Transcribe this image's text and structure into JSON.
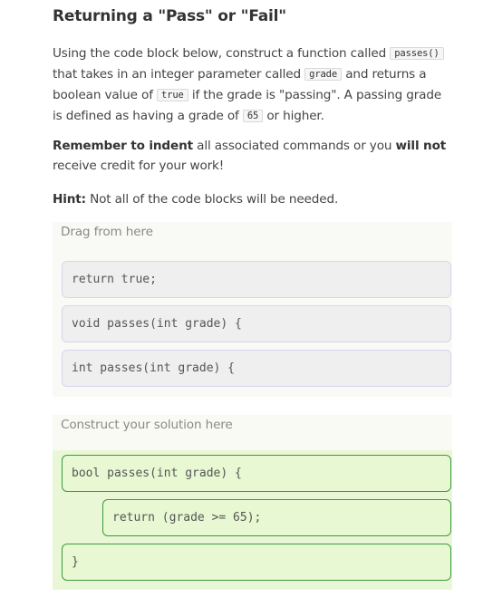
{
  "title": "Returning a \"Pass\" or \"Fail\"",
  "instructions": {
    "p1_a": "Using the code block below, construct a function called ",
    "p1_code1": "passes()",
    "p1_b": " that takes in an integer parameter called ",
    "p1_code2": "grade",
    "p1_c": " and returns a boolean value of ",
    "p1_code3": "true",
    "p1_d": " if the grade is \"passing\". A passing grade is defined as having a grade of ",
    "p1_code4": "65",
    "p1_e": " or higher.",
    "p2_bold1": "Remember to indent",
    "p2_mid": " all associated commands or you ",
    "p2_bold2": "will not",
    "p2_end": " receive credit for your work!",
    "hint_label": "Hint:",
    "hint_text": " Not all of the code blocks will be needed."
  },
  "source": {
    "label": "Drag from here",
    "blocks": [
      "return true;",
      "void passes(int grade) {",
      "int passes(int grade) {"
    ]
  },
  "solution": {
    "label": "Construct your solution here",
    "blocks": [
      {
        "text": "bool passes(int grade) {",
        "indent": 0
      },
      {
        "text": "return (grade >= 65);",
        "indent": 1
      },
      {
        "text": "}",
        "indent": 0
      }
    ]
  },
  "colors": {
    "solution_block_border": "#3c9a3c",
    "solution_block_bg": "#e8f8d2",
    "source_block_bg": "#efefef"
  }
}
